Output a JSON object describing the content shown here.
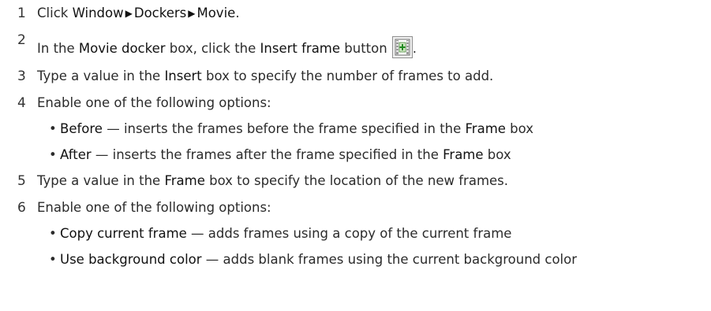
{
  "steps": [
    {
      "number": "1",
      "t1": "Click ",
      "ui1": "Window",
      "ui2": "Dockers",
      "ui3": "Movie",
      "t2": "."
    },
    {
      "number": "2",
      "t1": "In the ",
      "ui1": "Movie docker",
      "t2": " box, click the ",
      "ui2": "Insert frame",
      "t3": " button",
      "t4": "."
    },
    {
      "number": "3",
      "t1": "Type a value in the ",
      "ui1": "Insert",
      "t2": " box to specify the number of frames to add."
    },
    {
      "number": "4",
      "t1": "Enable one of the following options:"
    },
    {
      "number": "5",
      "t1": "Type a value in the ",
      "ui1": "Frame",
      "t2": " box to specify the location of the new frames."
    },
    {
      "number": "6",
      "t1": "Enable one of the following options:"
    }
  ],
  "bullets": [
    {
      "ui": "Before",
      "t1": " — inserts the frames before the frame specified in the ",
      "ui2": "Frame",
      "t2": " box"
    },
    {
      "ui": "After",
      "t1": " — inserts the frames after the frame specified in the ",
      "ui2": "Frame",
      "t2": " box"
    },
    {
      "ui": "Copy current frame",
      "t1": " — adds frames using a copy of the current frame"
    },
    {
      "ui": "Use background color",
      "t1": " — adds blank frames using the current background color"
    }
  ],
  "icons": {
    "separator": "triangle-right-icon",
    "insert_frame": "insert-frame-icon"
  }
}
